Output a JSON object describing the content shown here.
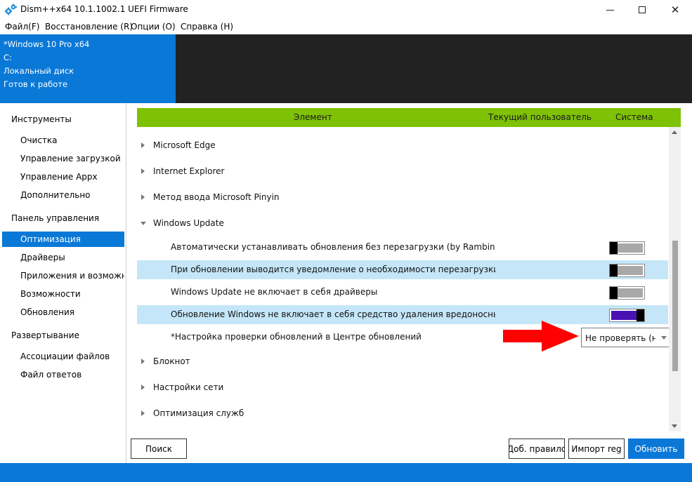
{
  "window": {
    "title": "Dism++x64 10.1.1002.1 UEFI Firmware",
    "minimize_icon": "minimize-icon",
    "maximize_icon": "maximize-icon",
    "close_icon": "close-icon",
    "close_glyph": "✕"
  },
  "menu": [
    "Файл(F)",
    "Восстановление (R)",
    "Опции (O)",
    "Справка (H)"
  ],
  "session": {
    "os": "*Windows 10 Pro x64",
    "drive": "C:",
    "disk_label": "Локальный диск",
    "status": "Готов к работе"
  },
  "sidebar": {
    "groups": [
      {
        "title": "Инструменты",
        "items": [
          "Очистка",
          "Управление загрузкой",
          "Управление Appx",
          "Дополнительно"
        ]
      },
      {
        "title": "Панель управления",
        "items": [
          "Оптимизация",
          "Драйверы",
          "Приложения и возможности",
          "Возможности",
          "Обновления"
        ]
      },
      {
        "title": "Развертывание",
        "items": [
          "Ассоциации файлов",
          "Файл ответов"
        ]
      }
    ],
    "active_item": "Оптимизация"
  },
  "columns": {
    "element": "Элемент",
    "current_user": "Текущий пользователь",
    "system": "Система"
  },
  "tree": {
    "groups_before": [
      "Microsoft Edge",
      "Internet Explorer",
      "Метод ввода Microsoft Pinyin"
    ],
    "expanded_group": "Windows Update",
    "options": [
      {
        "label": "Автоматически устанавливать обновления без перезагрузки (by Rambin)",
        "enabled": false,
        "selected": false
      },
      {
        "label": "При обновлении выводится уведомление о необходимости перезагрузки (by Rambin)",
        "enabled": false,
        "selected": true
      },
      {
        "label": "Windows Update не включает в себя драйверы",
        "enabled": false,
        "selected": false
      },
      {
        "label": "Обновление Windows не включает в себя средство удаления вредоносных программ",
        "enabled": true,
        "selected": true
      }
    ],
    "combo_option": {
      "label": "*Настройка проверки обновлений в Центре обновлений",
      "value": "Не проверять (не рекомендуется)"
    },
    "groups_after": [
      "Блокнот",
      "Настройки сети",
      "Оптимизация служб"
    ]
  },
  "annotation": {
    "arrow_color": "#ff0000"
  },
  "buttons": {
    "search": "Поиск",
    "add_rule": "Доб. правило",
    "import_reg": "Импорт reg",
    "update": "Обновить"
  },
  "colors": {
    "accent": "#0a78d7",
    "header_bar": "#7ec105",
    "toggle_on": "#4a12b3",
    "row_selected": "#c5e6f8"
  }
}
